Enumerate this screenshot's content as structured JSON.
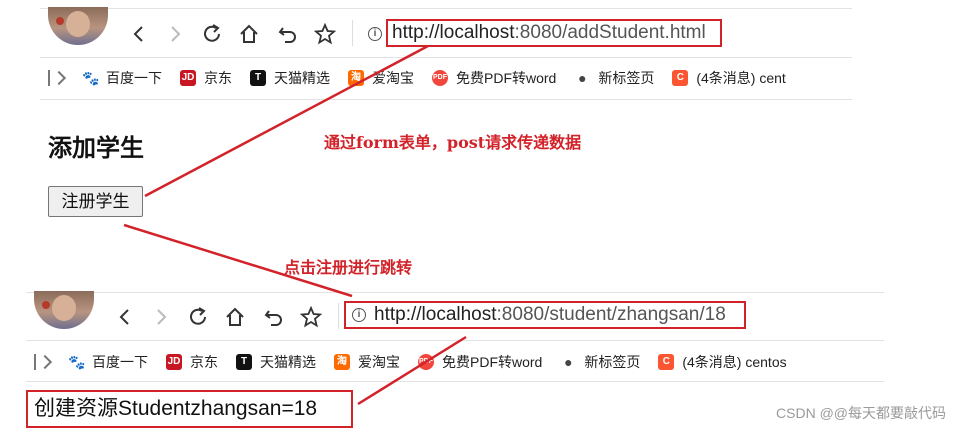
{
  "top_browser": {
    "url_host": "http://localhost",
    "url_rest": ":8080/addStudent.html",
    "bookmarks": [
      {
        "icon": "baidu-icon",
        "label": "百度一下",
        "color": "#2932e1",
        "glyph": "🐾"
      },
      {
        "icon": "jd-icon",
        "label": "京东",
        "color": "#c91623",
        "glyph": "JD"
      },
      {
        "icon": "tmall-icon",
        "label": "天猫精选",
        "color": "#111111",
        "glyph": "T"
      },
      {
        "icon": "taobao-icon",
        "label": "爱淘宝",
        "color": "#ff6a00",
        "glyph": "淘"
      },
      {
        "icon": "pdf-icon",
        "label": "免费PDF转word",
        "color": "#f0463c",
        "glyph": "PDF"
      },
      {
        "icon": "globe-icon",
        "label": "新标签页",
        "color": "#444444",
        "glyph": "●"
      },
      {
        "icon": "csdn-icon",
        "label": "(4条消息) cent",
        "color": "#fc5531",
        "glyph": "C"
      }
    ]
  },
  "bottom_browser": {
    "url_host": "http://localhost",
    "url_rest": ":8080/student/zhangsan/18",
    "bookmarks": [
      {
        "icon": "baidu-icon",
        "label": "百度一下",
        "color": "#2932e1",
        "glyph": "🐾"
      },
      {
        "icon": "jd-icon",
        "label": "京东",
        "color": "#c91623",
        "glyph": "JD"
      },
      {
        "icon": "tmall-icon",
        "label": "天猫精选",
        "color": "#111111",
        "glyph": "T"
      },
      {
        "icon": "taobao-icon",
        "label": "爱淘宝",
        "color": "#ff6a00",
        "glyph": "淘"
      },
      {
        "icon": "pdf-icon",
        "label": "免费PDF转word",
        "color": "#f0463c",
        "glyph": "PDF"
      },
      {
        "icon": "globe-icon",
        "label": "新标签页",
        "color": "#444444",
        "glyph": "●"
      },
      {
        "icon": "csdn-icon",
        "label": "(4条消息) centos",
        "color": "#fc5531",
        "glyph": "C"
      }
    ]
  },
  "page": {
    "heading": "添加学生",
    "register_button": "注册学生",
    "result_text": "创建资源Studentzhangsan=18"
  },
  "annotations": {
    "form_note": "通过form表单，post请求传递数据",
    "click_note": "点击注册进行跳转"
  },
  "watermark": "CSDN @@每天都要敲代码",
  "colors": {
    "highlight_red": "#d3232a"
  }
}
